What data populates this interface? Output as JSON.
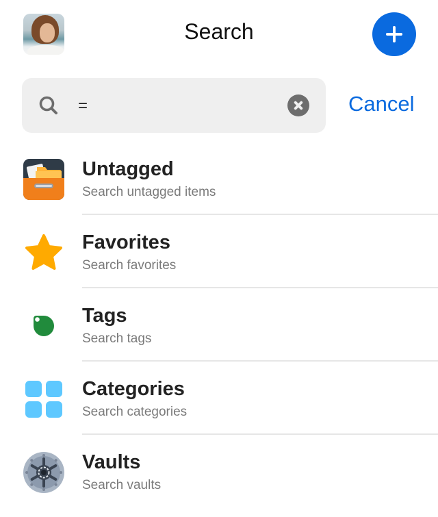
{
  "header": {
    "title": "Search",
    "avatar_alt": "User avatar",
    "add_icon": "plus-icon"
  },
  "search": {
    "value": "=",
    "placeholder": "",
    "search_icon": "magnifying-glass-icon",
    "clear_icon": "clear-x-icon",
    "cancel_label": "Cancel"
  },
  "colors": {
    "accent": "#0A6ADF",
    "untagged": "#F07F1B",
    "favorites": "#FFAA00",
    "tags": "#218B3C",
    "categories": "#5EC8FF",
    "vaults": "#8C9AAD"
  },
  "items": [
    {
      "label": "Untagged",
      "subtitle": "Search untagged items",
      "icon": "drawer-folder-icon"
    },
    {
      "label": "Favorites",
      "subtitle": "Search favorites",
      "icon": "star-icon"
    },
    {
      "label": "Tags",
      "subtitle": "Search tags",
      "icon": "tag-icon"
    },
    {
      "label": "Categories",
      "subtitle": "Search categories",
      "icon": "grid-icon"
    },
    {
      "label": "Vaults",
      "subtitle": "Search vaults",
      "icon": "vault-icon"
    }
  ]
}
